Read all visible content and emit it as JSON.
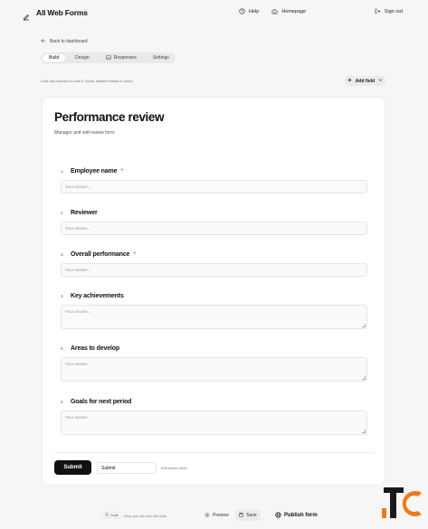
{
  "header": {
    "title": "All Web Forms",
    "nav": [
      {
        "label": "Help",
        "icon": "help-circle-icon"
      },
      {
        "label": "Homepage",
        "icon": "home-icon"
      }
    ],
    "signout_label": "Sign out"
  },
  "back_label": "Back to dashboard",
  "tabs": [
    {
      "label": "Build",
      "active": true
    },
    {
      "label": "Design",
      "active": false
    },
    {
      "label": "Responses",
      "active": false
    },
    {
      "label": "Settings",
      "active": false
    }
  ],
  "hint": "Click any element to edit it. Hover between fields to insert.",
  "add_field_label": "Add field",
  "form": {
    "title": "Performance review",
    "description": "Manager and self-review form.",
    "questions": [
      {
        "num": "1.",
        "label": "Employee name",
        "required": true,
        "placeholder": "Your answer...",
        "type": "short"
      },
      {
        "num": "2.",
        "label": "Reviewer",
        "required": false,
        "placeholder": "Your answer...",
        "type": "short"
      },
      {
        "num": "3.",
        "label": "Overall performance",
        "required": true,
        "placeholder": "Your answer...",
        "type": "short"
      },
      {
        "num": "4.",
        "label": "Key achievements",
        "required": false,
        "placeholder": "Your answer...",
        "type": "long"
      },
      {
        "num": "5.",
        "label": "Areas to develop",
        "required": false,
        "placeholder": "Your answer...",
        "type": "long"
      },
      {
        "num": "6.",
        "label": "Goals for next period",
        "required": false,
        "placeholder": "Your answer...",
        "type": "long"
      }
    ],
    "required_mark": "*",
    "submit_label": "Submit",
    "submit_label_value": "Submit",
    "edit_hint": "Edit button label"
  },
  "footer": {
    "status": "Draft",
    "status_hint": "Only you can see this form",
    "preview_label": "Preview",
    "save_label": "Save",
    "publish_label": "Publish form"
  },
  "colors": {
    "accent": "#111111",
    "required": "#d93a3a",
    "logo_orange": "#f07a1a",
    "logo_dark": "#1a1a1a"
  }
}
